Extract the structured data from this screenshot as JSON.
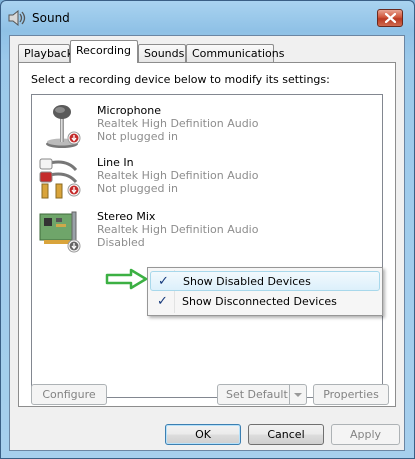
{
  "window": {
    "title": "Sound"
  },
  "tabs": [
    {
      "label": "Playback",
      "active": false
    },
    {
      "label": "Recording",
      "active": true
    },
    {
      "label": "Sounds",
      "active": false
    },
    {
      "label": "Communications",
      "active": false
    }
  ],
  "panel": {
    "instruction": "Select a recording device below to modify its settings:"
  },
  "devices": [
    {
      "name": "Microphone",
      "driver": "Realtek High Definition Audio",
      "status": "Not plugged in",
      "icon": "microphone-icon"
    },
    {
      "name": "Line In",
      "driver": "Realtek High Definition Audio",
      "status": "Not plugged in",
      "icon": "line-in-icon"
    },
    {
      "name": "Stereo Mix",
      "driver": "Realtek High Definition Audio",
      "status": "Disabled",
      "icon": "sound-card-icon"
    }
  ],
  "context_menu": {
    "items": [
      {
        "label": "Show Disabled Devices",
        "checked": true
      },
      {
        "label": "Show Disconnected Devices",
        "checked": true
      }
    ],
    "check_glyph": "✓"
  },
  "buttons": {
    "configure": "Configure",
    "set_default": "Set Default",
    "properties": "Properties",
    "ok": "OK",
    "cancel": "Cancel",
    "apply": "Apply"
  },
  "colors": {
    "accent_check": "#16397b",
    "disabled_text": "#8d8d8d",
    "annotation_arrow": "#3cb043",
    "close_button": "#c8442b"
  }
}
